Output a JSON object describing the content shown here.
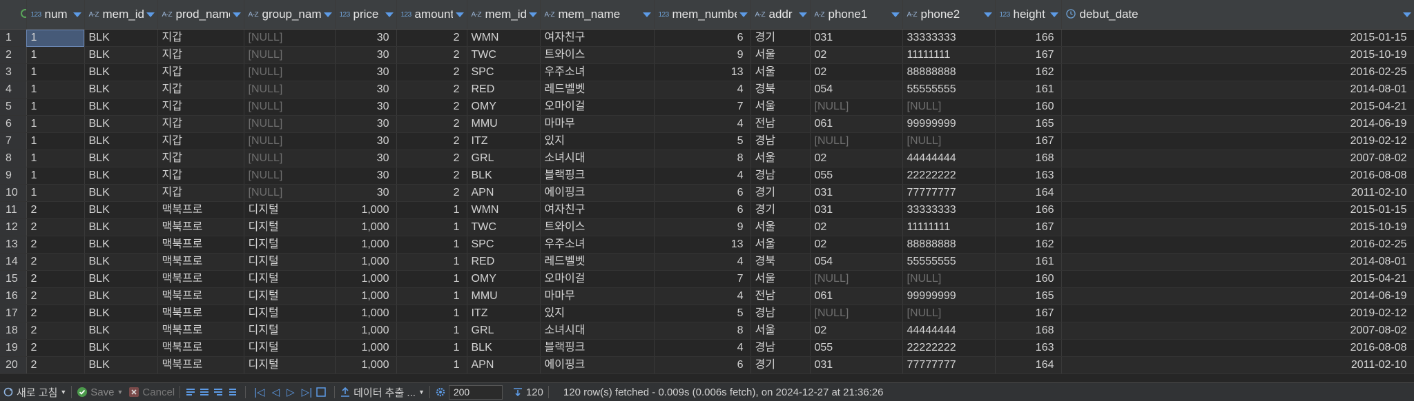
{
  "columns": [
    {
      "type": "123",
      "name": "num"
    },
    {
      "type": "A-Z",
      "name": "mem_id"
    },
    {
      "type": "A-Z",
      "name": "prod_name"
    },
    {
      "type": "A-Z",
      "name": "group_name"
    },
    {
      "type": "123",
      "name": "price"
    },
    {
      "type": "123",
      "name": "amount"
    },
    {
      "type": "A-Z",
      "name": "mem_id"
    },
    {
      "type": "A-Z",
      "name": "mem_name"
    },
    {
      "type": "123",
      "name": "mem_number"
    },
    {
      "type": "A-Z",
      "name": "addr"
    },
    {
      "type": "A-Z",
      "name": "phone1"
    },
    {
      "type": "A-Z",
      "name": "phone2"
    },
    {
      "type": "123",
      "name": "height"
    },
    {
      "type": "clock",
      "name": "debut_date"
    }
  ],
  "rows": [
    [
      "1",
      "1",
      "BLK",
      "지갑",
      "[NULL]",
      "30",
      "2",
      "WMN",
      "여자친구",
      "6",
      "경기",
      "031",
      "33333333",
      "166",
      "2015-01-15"
    ],
    [
      "2",
      "1",
      "BLK",
      "지갑",
      "[NULL]",
      "30",
      "2",
      "TWC",
      "트와이스",
      "9",
      "서울",
      "02",
      "11111111",
      "167",
      "2015-10-19"
    ],
    [
      "3",
      "1",
      "BLK",
      "지갑",
      "[NULL]",
      "30",
      "2",
      "SPC",
      "우주소녀",
      "13",
      "서울",
      "02",
      "88888888",
      "162",
      "2016-02-25"
    ],
    [
      "4",
      "1",
      "BLK",
      "지갑",
      "[NULL]",
      "30",
      "2",
      "RED",
      "레드벨벳",
      "4",
      "경북",
      "054",
      "55555555",
      "161",
      "2014-08-01"
    ],
    [
      "5",
      "1",
      "BLK",
      "지갑",
      "[NULL]",
      "30",
      "2",
      "OMY",
      "오마이걸",
      "7",
      "서울",
      "[NULL]",
      "[NULL]",
      "160",
      "2015-04-21"
    ],
    [
      "6",
      "1",
      "BLK",
      "지갑",
      "[NULL]",
      "30",
      "2",
      "MMU",
      "마마무",
      "4",
      "전남",
      "061",
      "99999999",
      "165",
      "2014-06-19"
    ],
    [
      "7",
      "1",
      "BLK",
      "지갑",
      "[NULL]",
      "30",
      "2",
      "ITZ",
      "있지",
      "5",
      "경남",
      "[NULL]",
      "[NULL]",
      "167",
      "2019-02-12"
    ],
    [
      "8",
      "1",
      "BLK",
      "지갑",
      "[NULL]",
      "30",
      "2",
      "GRL",
      "소녀시대",
      "8",
      "서울",
      "02",
      "44444444",
      "168",
      "2007-08-02"
    ],
    [
      "9",
      "1",
      "BLK",
      "지갑",
      "[NULL]",
      "30",
      "2",
      "BLK",
      "블랙핑크",
      "4",
      "경남",
      "055",
      "22222222",
      "163",
      "2016-08-08"
    ],
    [
      "10",
      "1",
      "BLK",
      "지갑",
      "[NULL]",
      "30",
      "2",
      "APN",
      "에이핑크",
      "6",
      "경기",
      "031",
      "77777777",
      "164",
      "2011-02-10"
    ],
    [
      "11",
      "2",
      "BLK",
      "맥북프로",
      "디지털",
      "1,000",
      "1",
      "WMN",
      "여자친구",
      "6",
      "경기",
      "031",
      "33333333",
      "166",
      "2015-01-15"
    ],
    [
      "12",
      "2",
      "BLK",
      "맥북프로",
      "디지털",
      "1,000",
      "1",
      "TWC",
      "트와이스",
      "9",
      "서울",
      "02",
      "11111111",
      "167",
      "2015-10-19"
    ],
    [
      "13",
      "2",
      "BLK",
      "맥북프로",
      "디지털",
      "1,000",
      "1",
      "SPC",
      "우주소녀",
      "13",
      "서울",
      "02",
      "88888888",
      "162",
      "2016-02-25"
    ],
    [
      "14",
      "2",
      "BLK",
      "맥북프로",
      "디지털",
      "1,000",
      "1",
      "RED",
      "레드벨벳",
      "4",
      "경북",
      "054",
      "55555555",
      "161",
      "2014-08-01"
    ],
    [
      "15",
      "2",
      "BLK",
      "맥북프로",
      "디지털",
      "1,000",
      "1",
      "OMY",
      "오마이걸",
      "7",
      "서울",
      "[NULL]",
      "[NULL]",
      "160",
      "2015-04-21"
    ],
    [
      "16",
      "2",
      "BLK",
      "맥북프로",
      "디지털",
      "1,000",
      "1",
      "MMU",
      "마마무",
      "4",
      "전남",
      "061",
      "99999999",
      "165",
      "2014-06-19"
    ],
    [
      "17",
      "2",
      "BLK",
      "맥북프로",
      "디지털",
      "1,000",
      "1",
      "ITZ",
      "있지",
      "5",
      "경남",
      "[NULL]",
      "[NULL]",
      "167",
      "2019-02-12"
    ],
    [
      "18",
      "2",
      "BLK",
      "맥북프로",
      "디지털",
      "1,000",
      "1",
      "GRL",
      "소녀시대",
      "8",
      "서울",
      "02",
      "44444444",
      "168",
      "2007-08-02"
    ],
    [
      "19",
      "2",
      "BLK",
      "맥북프로",
      "디지털",
      "1,000",
      "1",
      "BLK",
      "블랙핑크",
      "4",
      "경남",
      "055",
      "22222222",
      "163",
      "2016-08-08"
    ],
    [
      "20",
      "2",
      "BLK",
      "맥북프로",
      "디지털",
      "1,000",
      "1",
      "APN",
      "에이핑크",
      "6",
      "경기",
      "031",
      "77777777",
      "164",
      "2011-02-10"
    ]
  ],
  "toolbar": {
    "refresh_label": "새로 고침",
    "save_label": "Save",
    "cancel_label": "Cancel",
    "export_label": "데이터 추출 ...",
    "fetch_size": "200",
    "row_count": "120",
    "status": "120 row(s) fetched - 0.009s (0.006s fetch), on 2024-12-27 at 21:36:26"
  },
  "colors": {
    "accent": "#5d9be6",
    "null_text": "#6e6e6e",
    "selected_cell": "#465a78"
  }
}
